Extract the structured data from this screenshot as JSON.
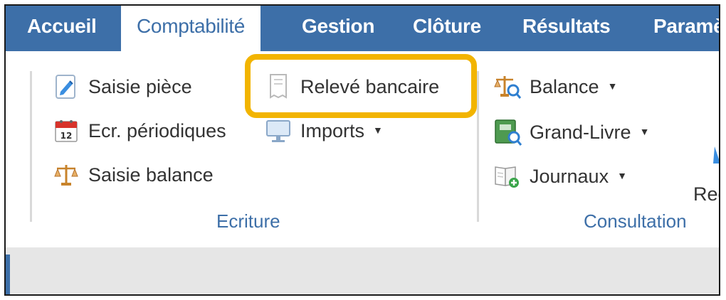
{
  "tabs": [
    {
      "label": "Accueil",
      "active": false
    },
    {
      "label": "Comptabilité",
      "active": true
    },
    {
      "label": "Gestion",
      "active": false
    },
    {
      "label": "Clôture",
      "active": false
    },
    {
      "label": "Résultats",
      "active": false
    },
    {
      "label": "Paramè",
      "active": false
    }
  ],
  "ecriture": {
    "label": "Ecriture",
    "items": [
      {
        "label": "Saisie pièce",
        "icon": "pencil-document-icon"
      },
      {
        "label": "Ecr. périodiques",
        "icon": "calendar-icon"
      },
      {
        "label": "Saisie balance",
        "icon": "scale-icon"
      },
      {
        "label": "Relevé bancaire",
        "icon": "bank-statement-icon"
      },
      {
        "label": "Imports",
        "icon": "monitor-import-icon",
        "dropdown": true
      }
    ]
  },
  "consultation": {
    "label": "Consultation",
    "items": [
      {
        "label": "Balance",
        "icon": "scale-search-icon",
        "dropdown": true
      },
      {
        "label": "Grand-Livre",
        "icon": "ledger-search-icon",
        "dropdown": true
      },
      {
        "label": "Journaux",
        "icon": "journal-add-icon",
        "dropdown": true
      }
    ]
  },
  "cut_off_item": {
    "label": "Rec"
  },
  "colors": {
    "accent": "#3d6fa8",
    "highlight": "#f2b400",
    "separator": "#d9d9d9"
  }
}
